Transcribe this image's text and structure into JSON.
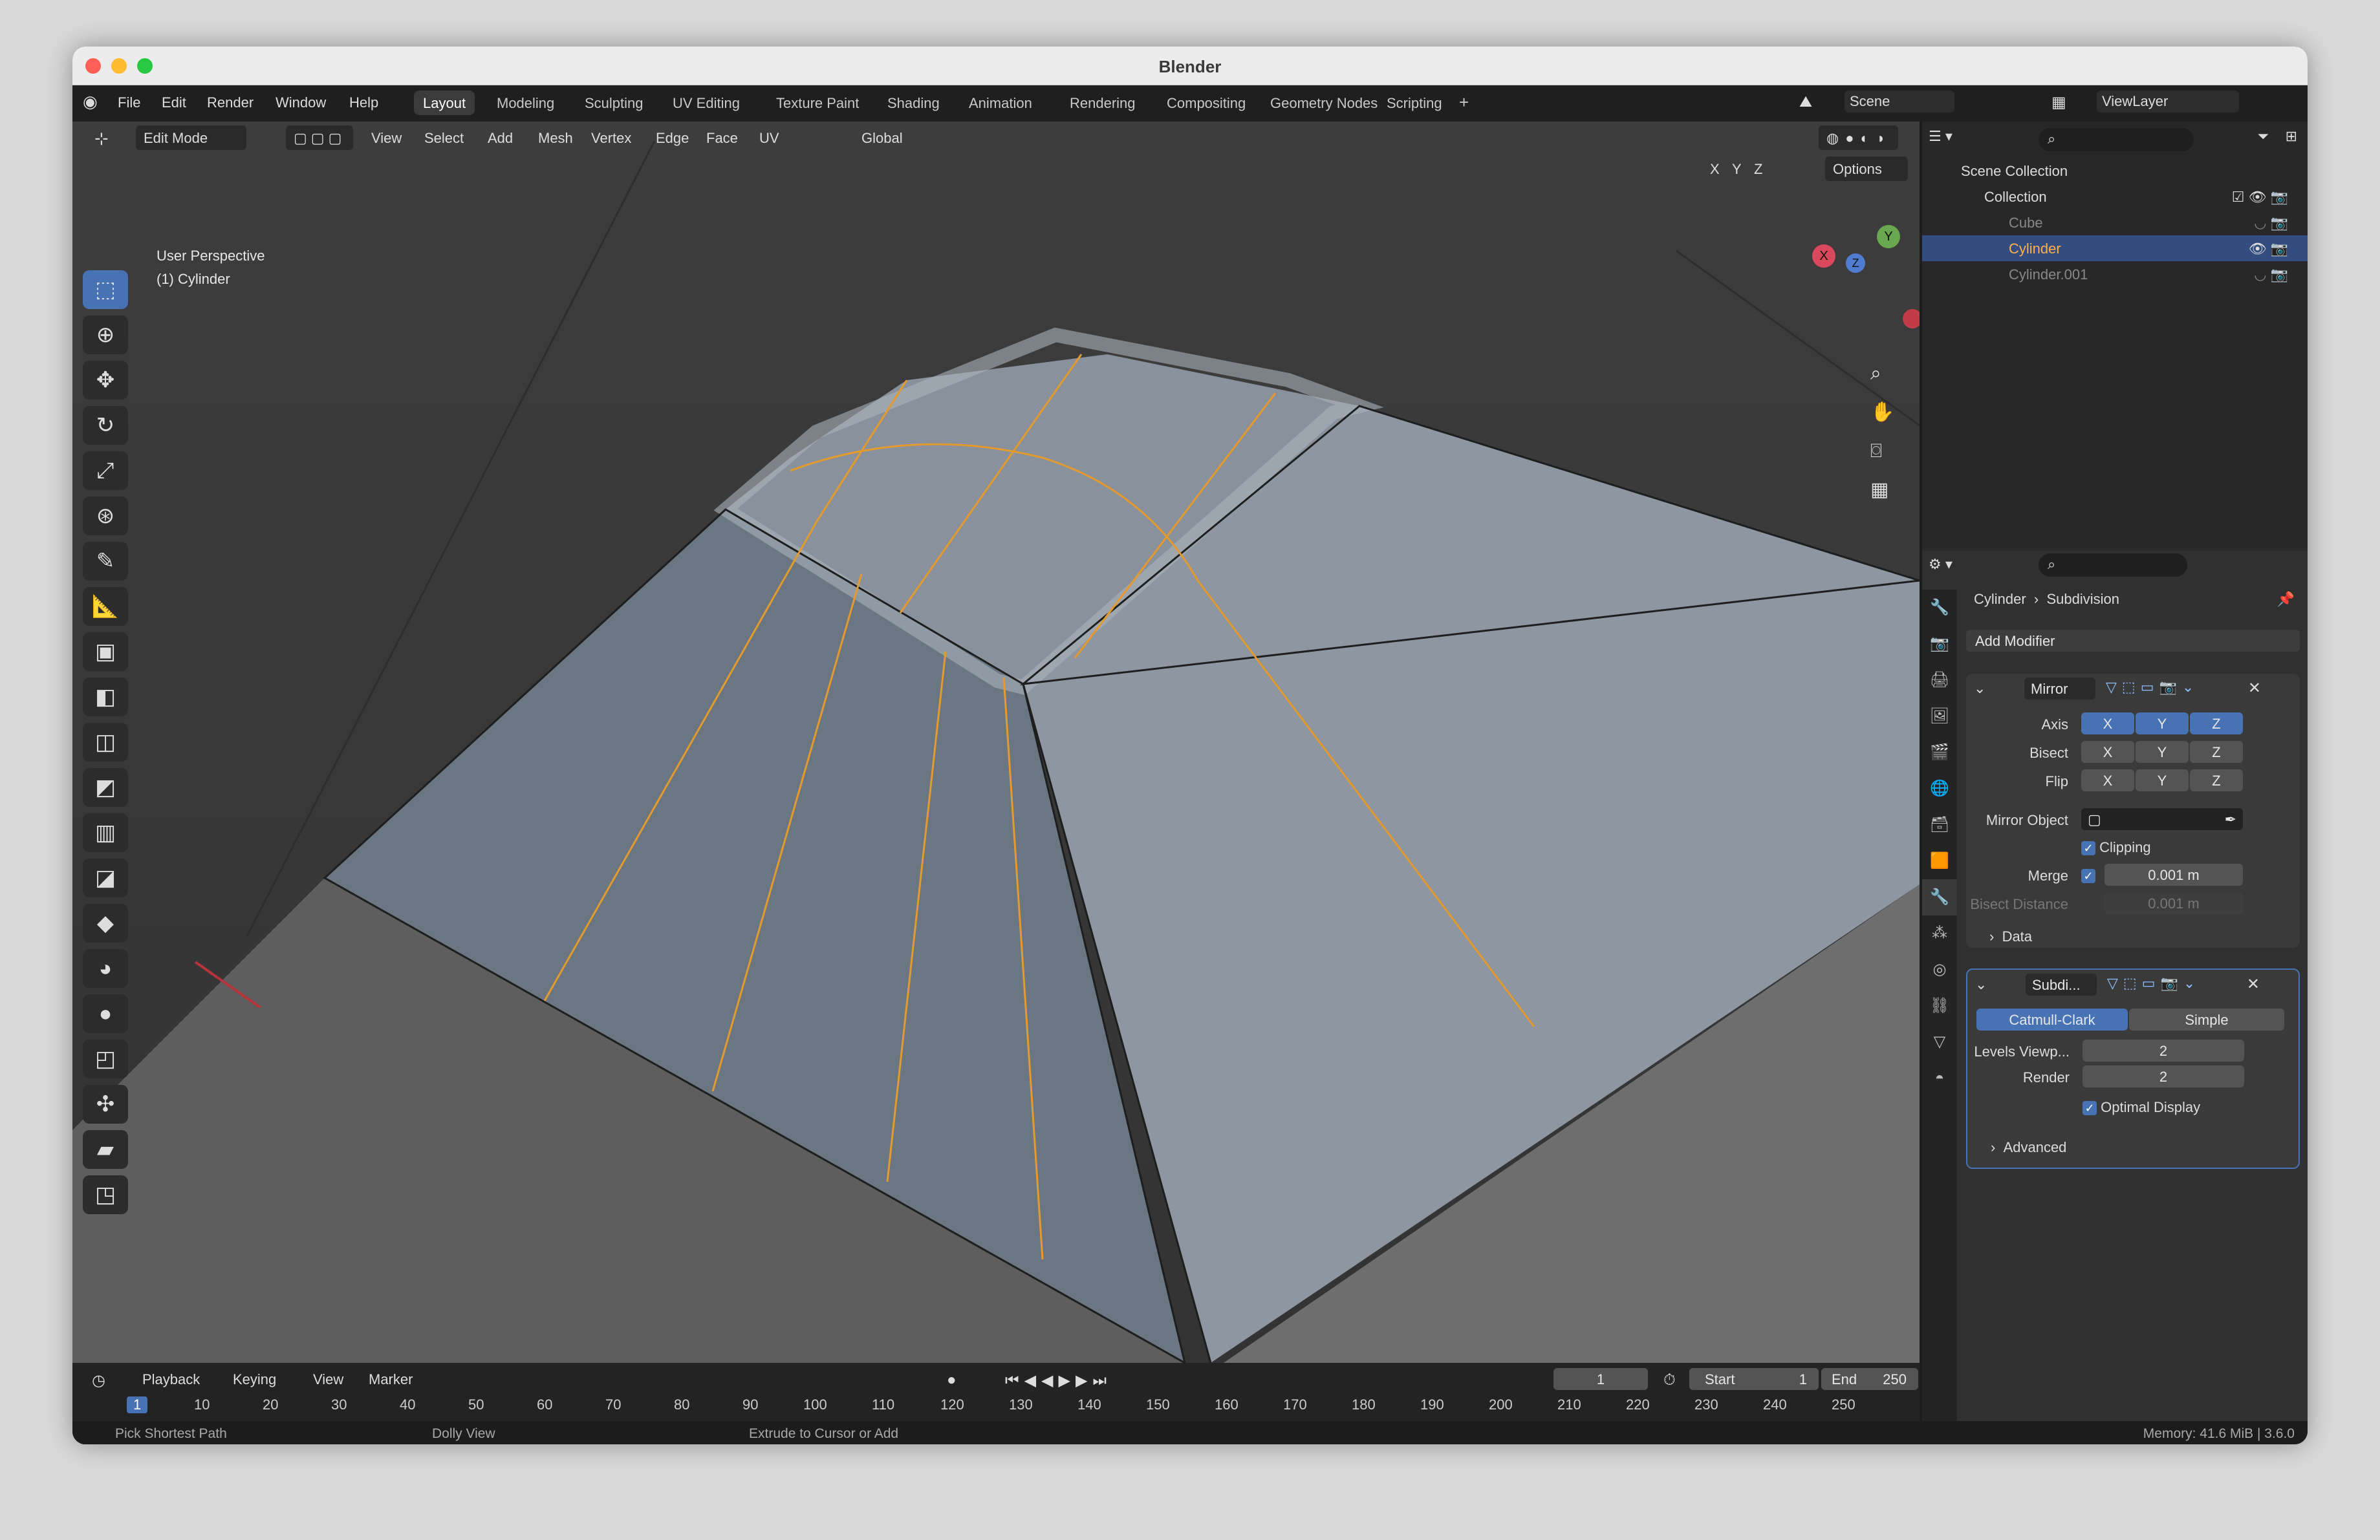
{
  "window": {
    "title": "Blender"
  },
  "menu": [
    "File",
    "Edit",
    "Render",
    "Window",
    "Help"
  ],
  "workspaces": [
    "Layout",
    "Modeling",
    "Sculpting",
    "UV Editing",
    "Texture Paint",
    "Shading",
    "Animation",
    "Rendering",
    "Compositing",
    "Geometry Nodes",
    "Scripting",
    "+"
  ],
  "scene": {
    "name": "Scene",
    "viewlayer": "ViewLayer"
  },
  "viewport": {
    "mode": "Edit Mode",
    "menus": [
      "View",
      "Select",
      "Add",
      "Mesh",
      "Vertex",
      "Edge",
      "Face",
      "UV"
    ],
    "transform": "Global",
    "options": "Options",
    "axes": [
      "X",
      "Y",
      "Z"
    ],
    "info_line1": "User Perspective",
    "info_line2": "(1) Cylinder"
  },
  "gizmo": {
    "x": "X",
    "y": "Y",
    "z": "Z"
  },
  "outliner": {
    "root": "Scene Collection",
    "collection": "Collection",
    "items": [
      "Cube",
      "Cylinder",
      "Cylinder.001"
    ]
  },
  "properties": {
    "breadcrumb_obj": "Cylinder",
    "breadcrumb_mod": "Subdivision",
    "add_modifier": "Add Modifier",
    "mirror": {
      "name": "Mirror",
      "axis_label": "Axis",
      "bisect_label": "Bisect",
      "flip_label": "Flip",
      "x": "X",
      "y": "Y",
      "z": "Z",
      "mirror_object": "Mirror Object",
      "clipping": "Clipping",
      "merge_label": "Merge",
      "merge_value": "0.001 m",
      "bisect_distance": "Bisect Distance",
      "bisect_distance_value": "0.001 m",
      "data": "Data"
    },
    "subdiv": {
      "name": "Subdi...",
      "catmull": "Catmull-Clark",
      "simple": "Simple",
      "levels_label": "Levels Viewp...",
      "levels": "2",
      "render_label": "Render",
      "render": "2",
      "optimal": "Optimal Display",
      "advanced": "Advanced"
    }
  },
  "timeline": {
    "menus": [
      "Playback",
      "Keying",
      "View",
      "Marker"
    ],
    "frame": "1",
    "start_label": "Start",
    "start": "1",
    "end_label": "End",
    "end": "250",
    "ticks": [
      "1",
      "10",
      "20",
      "30",
      "40",
      "50",
      "60",
      "70",
      "80",
      "90",
      "100",
      "110",
      "120",
      "130",
      "140",
      "150",
      "160",
      "170",
      "180",
      "190",
      "200",
      "210",
      "220",
      "230",
      "240",
      "250"
    ]
  },
  "status": {
    "left": "Pick Shortest Path",
    "mid": "Dolly View",
    "right": "Extrude to Cursor or Add",
    "memory": "Memory: 41.6 MiB | 3.6.0"
  },
  "colors": {
    "accent": "#4772b3",
    "edge_select": "#e39a2e",
    "mesh": "#8d96a1"
  }
}
